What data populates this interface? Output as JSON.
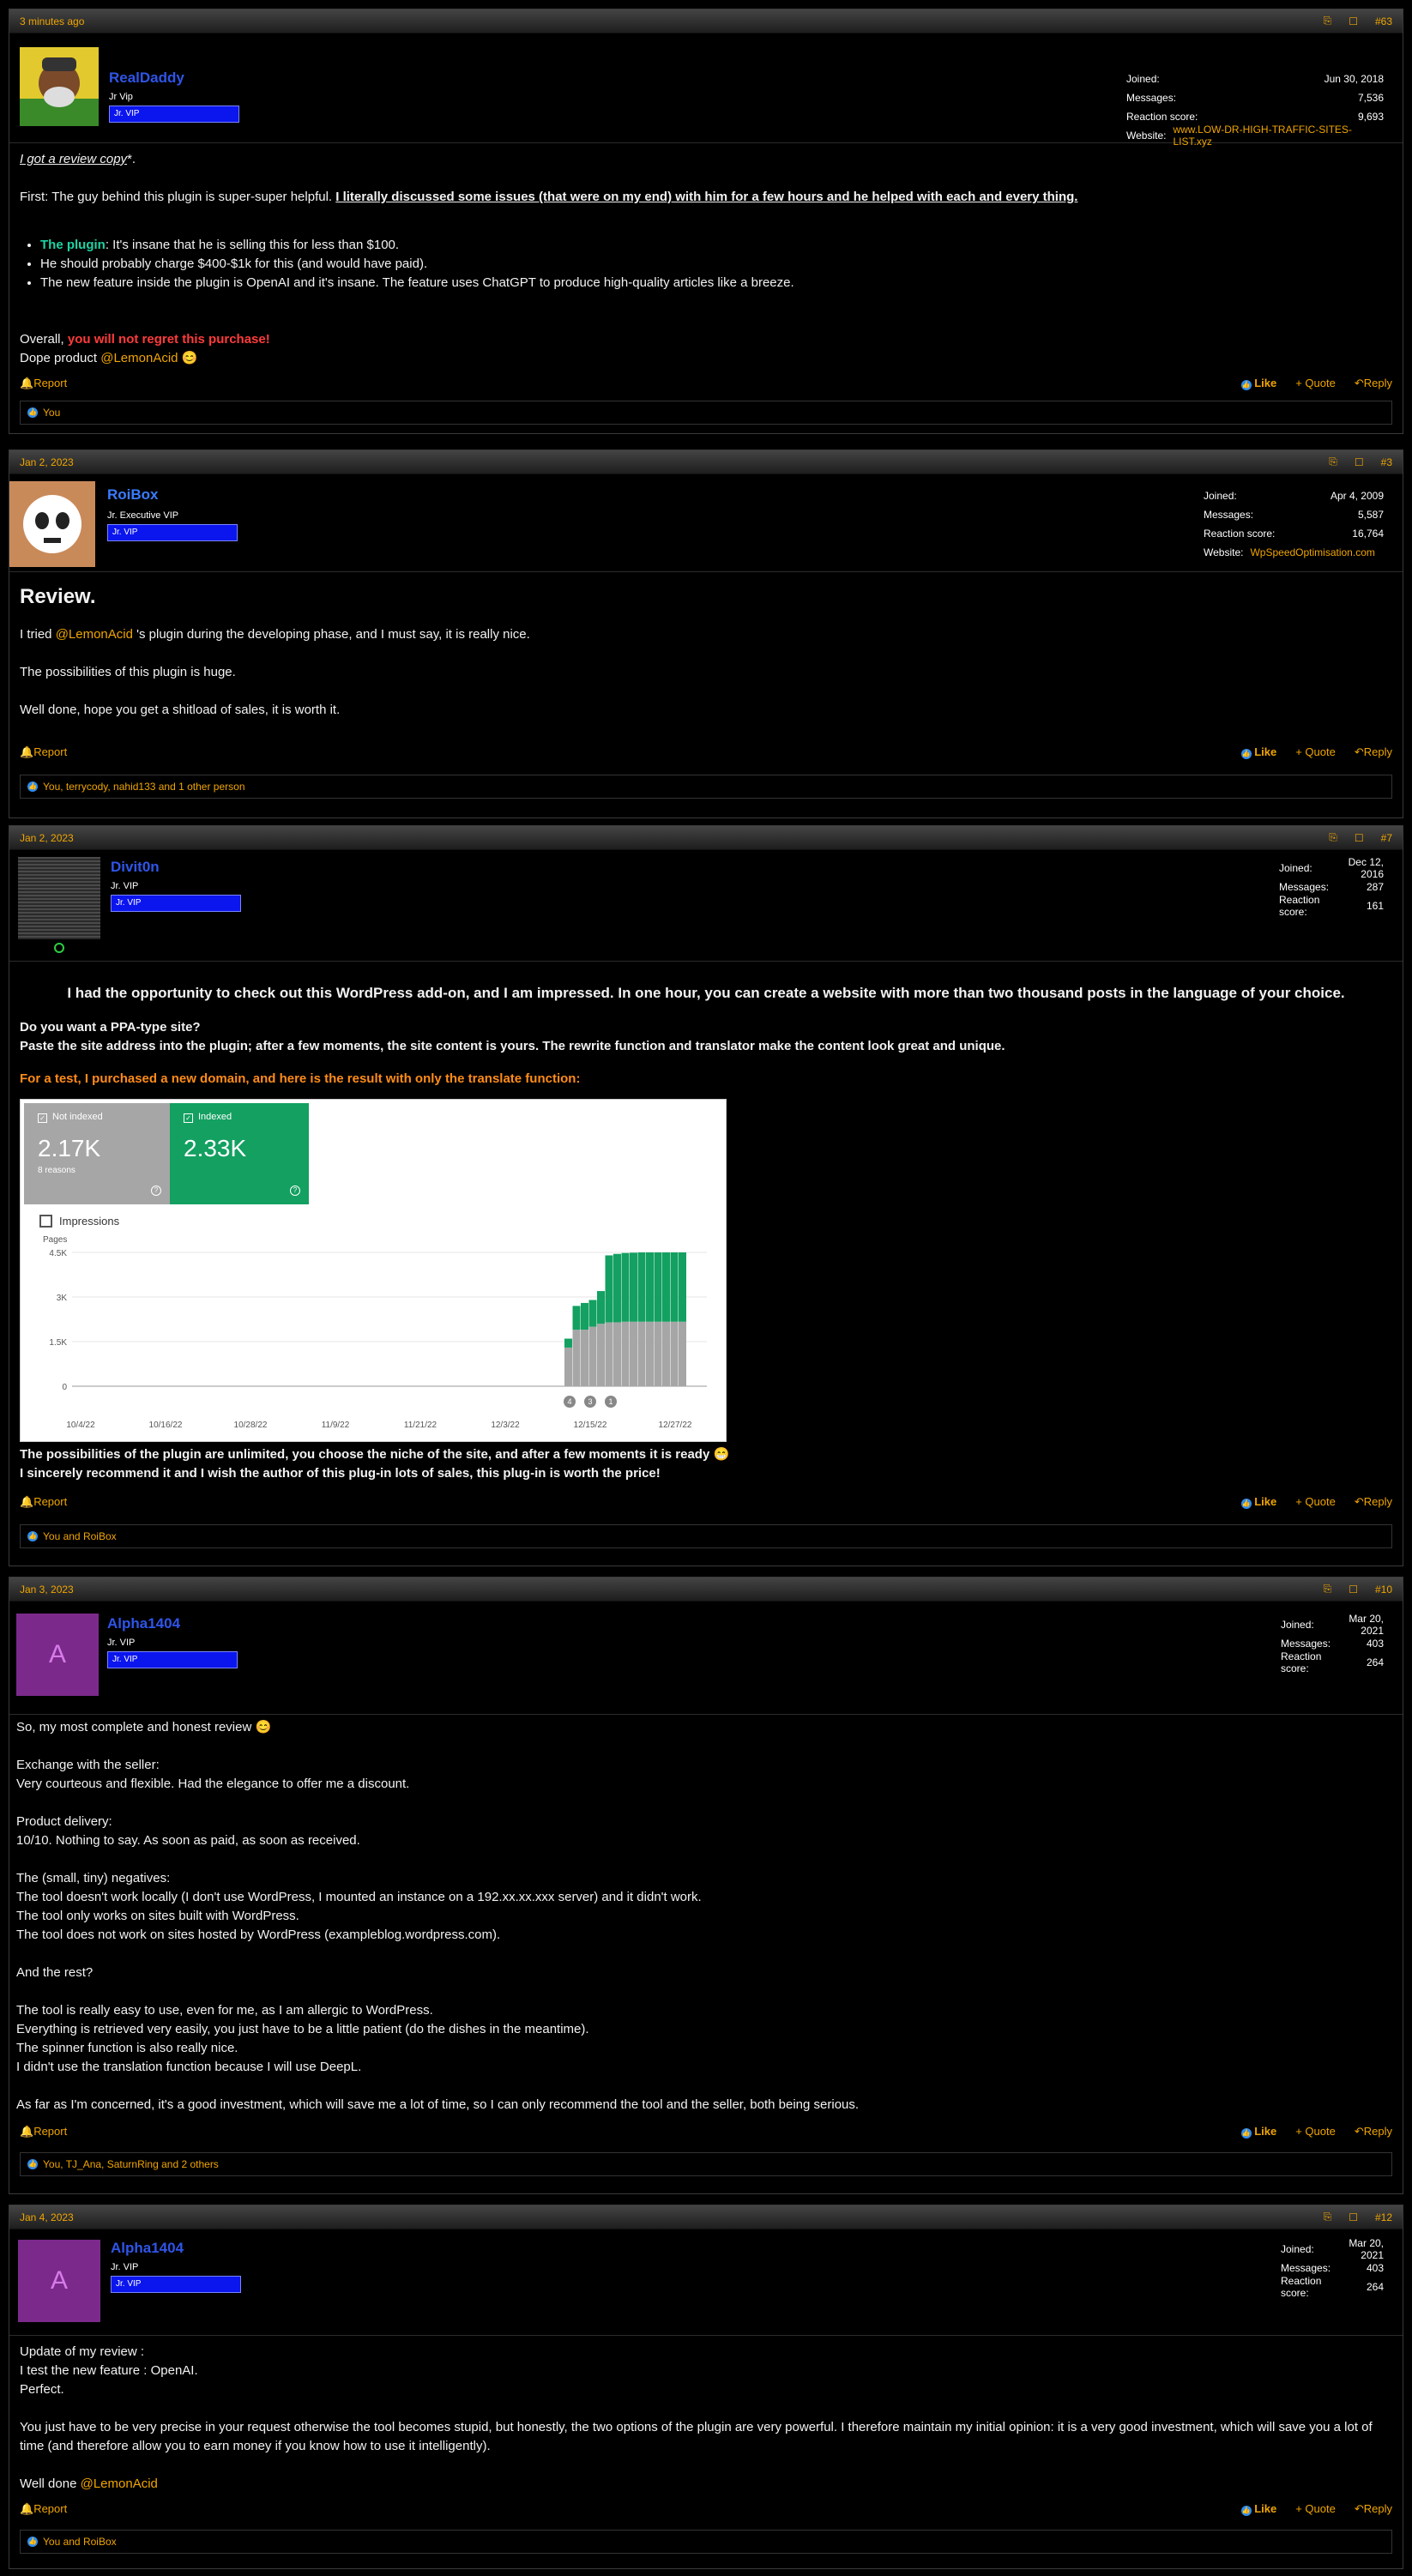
{
  "posts": [
    {
      "time": "3 minutes ago",
      "num": "#63",
      "user": "RealDaddy",
      "title": "Jr Vip",
      "banner": "Jr. VIP",
      "stats": [
        {
          "label": "Joined:",
          "value": "Jun 30, 2018"
        },
        {
          "label": "Messages:",
          "value": "7,536"
        },
        {
          "label": "Reaction score:",
          "value": "9,693"
        },
        {
          "label": "Website:",
          "value": "www.LOW-DR-HIGH-TRAFFIC-SITES-LIST.xyz"
        }
      ],
      "lines": {
        "l1": "I got a review copy",
        "l1b": "*.",
        "l2a": "First: The guy behind this plugin is super-super helpful. ",
        "l2b": "I literally discussed some issues (that were on my end) with him for a few hours and he helped with each and every thing.",
        "b1a": "The plugin",
        "b1b": ": It's insane that he is selling this for less than $100.",
        "b2": "He should probably charge $400-$1k for this (and would have paid).",
        "b3": "The new feature inside the plugin is OpenAI and it's insane. The feature uses ChatGPT to produce high-quality articles like a breeze.",
        "o1": "Overall, ",
        "o2": "you will not regret this purchase!",
        "d1": "Dope product ",
        "d2": "@LemonAcid",
        "emoji": "😊"
      },
      "reactions": "You"
    },
    {
      "time": "Jan 2, 2023",
      "num": "#3",
      "user": "RoiBox",
      "title": "Jr. Executive VIP",
      "banner": "Jr. VIP",
      "stats": [
        {
          "label": "Joined:",
          "value": "Apr 4, 2009"
        },
        {
          "label": "Messages:",
          "value": "5,587"
        },
        {
          "label": "Reaction score:",
          "value": "16,764"
        },
        {
          "label": "Website:",
          "value": "WpSpeedOptimisation.com"
        }
      ],
      "lines": {
        "h": "Review.",
        "a1": "I tried ",
        "a2": "@LemonAcid",
        "a3": " 's plugin during the developing phase, and I must say, it is really nice.",
        "b": "The possibilities of this plugin is huge.",
        "c": "Well done, hope you get a shitload of sales, it is worth it."
      },
      "reactions": "You, terrycody, nahid133 and 1 other person"
    },
    {
      "time": "Jan 2, 2023",
      "num": "#7",
      "user": "Divit0n",
      "title": "Jr. VIP",
      "banner": "Jr. VIP",
      "stats": [
        {
          "label": "Joined:",
          "value": "Dec 12, 2016"
        },
        {
          "label": "Messages:",
          "value": "287"
        },
        {
          "label": "Reaction score:",
          "value": "161"
        }
      ],
      "lines": {
        "h": "I had the opportunity to check out this WordPress add-on, and I am impressed. In one hour, you can create a website with more than two thousand posts in the language of your choice.",
        "q1": "Do you want a PPA-type site?",
        "q2": "Paste the site address into the plugin; after a few moments, the site content is yours. The rewrite function and translator make the content look great and unique.",
        "t": "For a test, I purchased a new domain, and here is the result with only the translate function:",
        "e1": "The possibilities of the plugin are unlimited, you choose the niche of the site, and after a few moments it is ready",
        "e1emoji": "😁",
        "e2": "I sincerely recommend it and I wish the author of this plug-in lots of sales, this plug-in is worth the price!"
      },
      "gsc": {
        "not_indexed_label": "Not indexed",
        "not_indexed_value": "2.17K",
        "not_indexed_sub": "8 reasons",
        "indexed_label": "Indexed",
        "indexed_value": "2.33K",
        "impressions": "Impressions",
        "colors": {
          "not_indexed": "#a6a6a6",
          "indexed": "#13a061"
        }
      },
      "reactions": "You and RoiBox"
    },
    {
      "time": "Jan 3, 2023",
      "num": "#10",
      "user": "Alpha1404",
      "title": "Jr. VIP",
      "banner": "Jr. VIP",
      "avatar_letter": "A",
      "stats": [
        {
          "label": "Joined:",
          "value": "Mar 20, 2021"
        },
        {
          "label": "Messages:",
          "value": "403"
        },
        {
          "label": "Reaction score:",
          "value": "264"
        }
      ],
      "lines": {
        "intro": "So, my most complete and honest review",
        "emoji": "😊",
        "ex1": "Exchange with the seller:",
        "ex2": "Very courteous and flexible. Had the elegance to offer me a discount.",
        "pd1": "Product delivery:",
        "pd2": "10/10. Nothing to say. As soon as paid, as soon as received.",
        "n1": "The (small, tiny) negatives:",
        "n2": "The tool doesn't work locally (I don't use WordPress, I mounted an instance on a 192.xx.xx.xxx server) and it didn't work.",
        "n3": "The tool only works on sites built with WordPress.",
        "n4": "The tool does not work on sites hosted by WordPress (exampleblog.wordpress.com).",
        "r0": "And the rest?",
        "r1": "The tool is really easy to use, even for me, as I am allergic to WordPress.",
        "r2": "Everything is retrieved very easily, you just have to be a little patient (do the dishes in the meantime).",
        "r3": "The spinner function is also really nice.",
        "r4": "I didn't use the translation function because I will use DeepL.",
        "f": "As far as I'm concerned, it's a good investment, which will save me a lot of time, so I can only recommend the tool and the seller, both being serious."
      },
      "reactions": "You, TJ_Ana, SaturnRing and 2 others"
    },
    {
      "time": "Jan 4, 2023",
      "num": "#12",
      "user": "Alpha1404",
      "title": "Jr. VIP",
      "banner": "Jr. VIP",
      "avatar_letter": "A",
      "stats": [
        {
          "label": "Joined:",
          "value": "Mar 20, 2021"
        },
        {
          "label": "Messages:",
          "value": "403"
        },
        {
          "label": "Reaction score:",
          "value": "264"
        }
      ],
      "lines": {
        "u1": "Update of my review :",
        "u2": "I test the new feature : OpenAI.",
        "u3": "Perfect.",
        "p": "You just have to be very precise in your request otherwise the tool becomes stupid, but honestly, the two options of the plugin are very powerful. I therefore maintain my initial opinion: it is a very good investment, which will save you a lot of time (and therefore allow you to earn money if you know how to use it intelligently).",
        "w1": "Well done ",
        "w2": "@LemonAcid"
      },
      "reactions": "You and RoiBox"
    }
  ],
  "actions": {
    "report": "Report",
    "like": "Like",
    "quote": "+ Quote",
    "reply": "Reply"
  },
  "chart_data": {
    "type": "bar",
    "ylabel": "Pages",
    "yticks": [
      "0",
      "1.5K",
      "3K",
      "4.5K"
    ],
    "ylim": [
      0,
      4500
    ],
    "xticks": [
      "10/4/22",
      "10/16/22",
      "10/28/22",
      "11/9/22",
      "11/21/22",
      "12/3/22",
      "12/15/22",
      "12/27/22"
    ],
    "annotations": [
      "4",
      "3",
      "1"
    ],
    "series": [
      {
        "name": "Not indexed",
        "color": "#a6a6a6",
        "values": [
          1300,
          1900,
          1900,
          2000,
          2100,
          2150,
          2150,
          2170,
          2170,
          2170,
          2170,
          2170,
          2170,
          2170,
          2170
        ]
      },
      {
        "name": "Indexed",
        "color": "#13a061",
        "values": [
          300,
          800,
          900,
          900,
          1100,
          2250,
          2300,
          2310,
          2320,
          2330,
          2330,
          2330,
          2330,
          2330,
          2330
        ]
      }
    ]
  }
}
